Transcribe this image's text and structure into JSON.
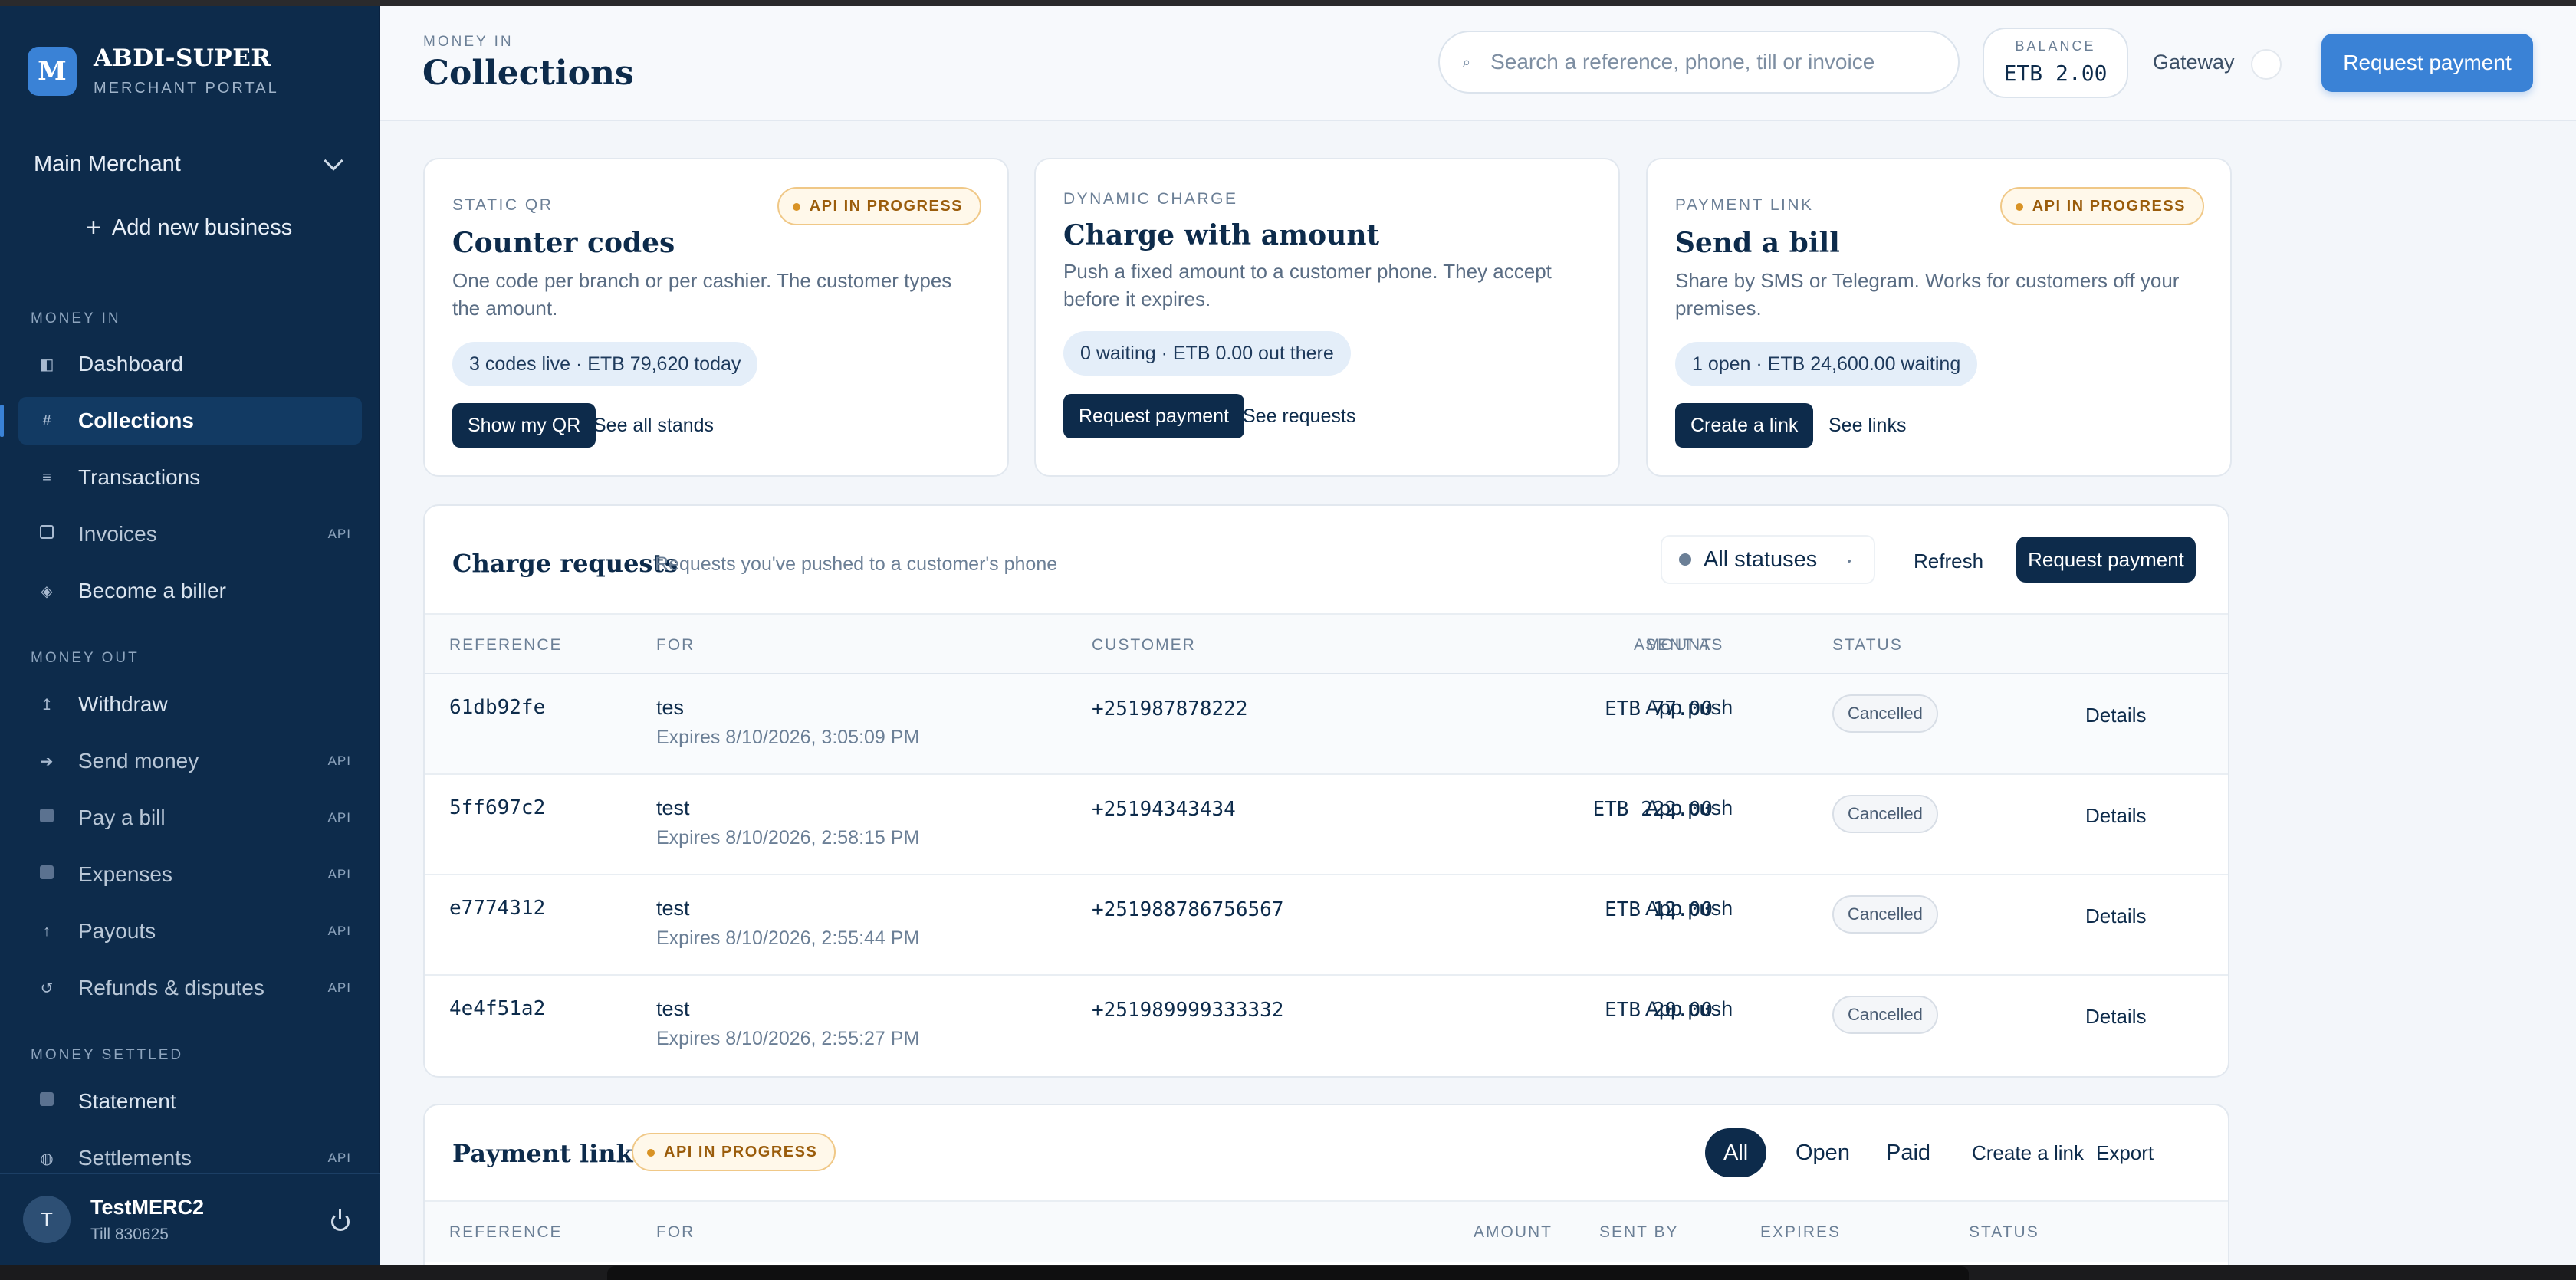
{
  "sidebar": {
    "brand_mark": "M",
    "brand_name": "ABDI-SUPER",
    "brand_sub": "MERCHANT PORTAL",
    "merchant": "Main Merchant",
    "add_business": "Add new business",
    "sections": {
      "money_in": "MONEY IN",
      "money_out": "MONEY OUT",
      "money_settled": "MONEY SETTLED"
    },
    "items": {
      "dashboard": {
        "label": "Dashboard",
        "icon": "◧"
      },
      "collections": {
        "label": "Collections",
        "icon": "#"
      },
      "transactions": {
        "label": "Transactions",
        "icon": "≡"
      },
      "invoices": {
        "label": "Invoices",
        "tag": "API"
      },
      "biller": {
        "label": "Become a biller",
        "icon": "◈"
      },
      "withdraw": {
        "label": "Withdraw",
        "icon": "↥"
      },
      "send_money": {
        "label": "Send money",
        "icon": "➔",
        "tag": "API"
      },
      "pay_bill": {
        "label": "Pay a bill",
        "tag": "API"
      },
      "expenses": {
        "label": "Expenses",
        "tag": "API"
      },
      "payouts": {
        "label": "Payouts",
        "icon": "↑",
        "tag": "API"
      },
      "refunds": {
        "label": "Refunds & disputes",
        "icon": "↺",
        "tag": "API"
      },
      "statement": {
        "label": "Statement"
      },
      "settlements": {
        "label": "Settlements",
        "icon": "◍",
        "tag": "API"
      }
    },
    "user": {
      "initial": "T",
      "name": "TestMERC2",
      "till": "Till 830625"
    }
  },
  "header": {
    "eyebrow": "MONEY IN",
    "title": "Collections",
    "search_placeholder": "Search a reference, phone, till or invoice",
    "search_icon": "⌕",
    "balance_label": "BALANCE",
    "balance_value": "ETB 2.00",
    "gateway_label": "Gateway",
    "request_payment": "Request payment"
  },
  "cards": {
    "static_qr": {
      "eyebrow": "STATIC QR",
      "badge": "API IN PROGRESS",
      "title": "Counter codes",
      "desc": "One code per branch or per cashier. The customer types the amount.",
      "stat": "3 codes live · ETB 79,620 today",
      "primary": "Show my QR",
      "secondary": "See all stands"
    },
    "dynamic": {
      "eyebrow": "DYNAMIC CHARGE",
      "title": "Charge with amount",
      "desc": "Push a fixed amount to a customer phone. They accept before it expires.",
      "stat": "0 waiting · ETB 0.00 out there",
      "primary": "Request payment",
      "secondary": "See requests"
    },
    "link": {
      "eyebrow": "PAYMENT LINK",
      "badge": "API IN PROGRESS",
      "title": "Send a bill",
      "desc": "Share by SMS or Telegram. Works for customers off your premises.",
      "stat": "1 open · ETB 24,600.00 waiting",
      "primary": "Create a link",
      "secondary": "See links"
    }
  },
  "charge_requests": {
    "title": "Charge requests",
    "subtitle": "Requests you've pushed to a customer's phone",
    "filter": "All statuses",
    "refresh": "Refresh",
    "request_payment": "Request payment",
    "columns": [
      "REFERENCE",
      "FOR",
      "CUSTOMER",
      "AMOUNT",
      "SENT AS",
      "STATUS"
    ],
    "rows": [
      {
        "ref": "61db92fe",
        "for": "tes",
        "expires": "Expires 8/10/2026, 3:05:09 PM",
        "customer": "+251987878222",
        "amount": "ETB 77.00",
        "sent_as": "App push",
        "status": "Cancelled",
        "action": "Details"
      },
      {
        "ref": "5ff697c2",
        "for": "test",
        "expires": "Expires 8/10/2026, 2:58:15 PM",
        "customer": "+25194343434",
        "amount": "ETB 222.00",
        "sent_as": "App push",
        "status": "Cancelled",
        "action": "Details"
      },
      {
        "ref": "e7774312",
        "for": "test",
        "expires": "Expires 8/10/2026, 2:55:44 PM",
        "customer": "+251988786756567",
        "amount": "ETB 12.00",
        "sent_as": "App push",
        "status": "Cancelled",
        "action": "Details"
      },
      {
        "ref": "4e4f51a2",
        "for": "test",
        "expires": "Expires 8/10/2026, 2:55:27 PM",
        "customer": "+251989999333332",
        "amount": "ETB 20.00",
        "sent_as": "App push",
        "status": "Cancelled",
        "action": "Details"
      }
    ]
  },
  "payment_links": {
    "title": "Payment links",
    "badge": "API IN PROGRESS",
    "tabs": [
      "All",
      "Open",
      "Paid"
    ],
    "create": "Create a link",
    "export": "Export",
    "columns": [
      "REFERENCE",
      "FOR",
      "AMOUNT",
      "SENT BY",
      "EXPIRES",
      "STATUS"
    ]
  },
  "colors": {
    "sidebar_bg": "#0d2b4b",
    "accent": "#3a82d6",
    "warning": "#9a5c0b"
  }
}
